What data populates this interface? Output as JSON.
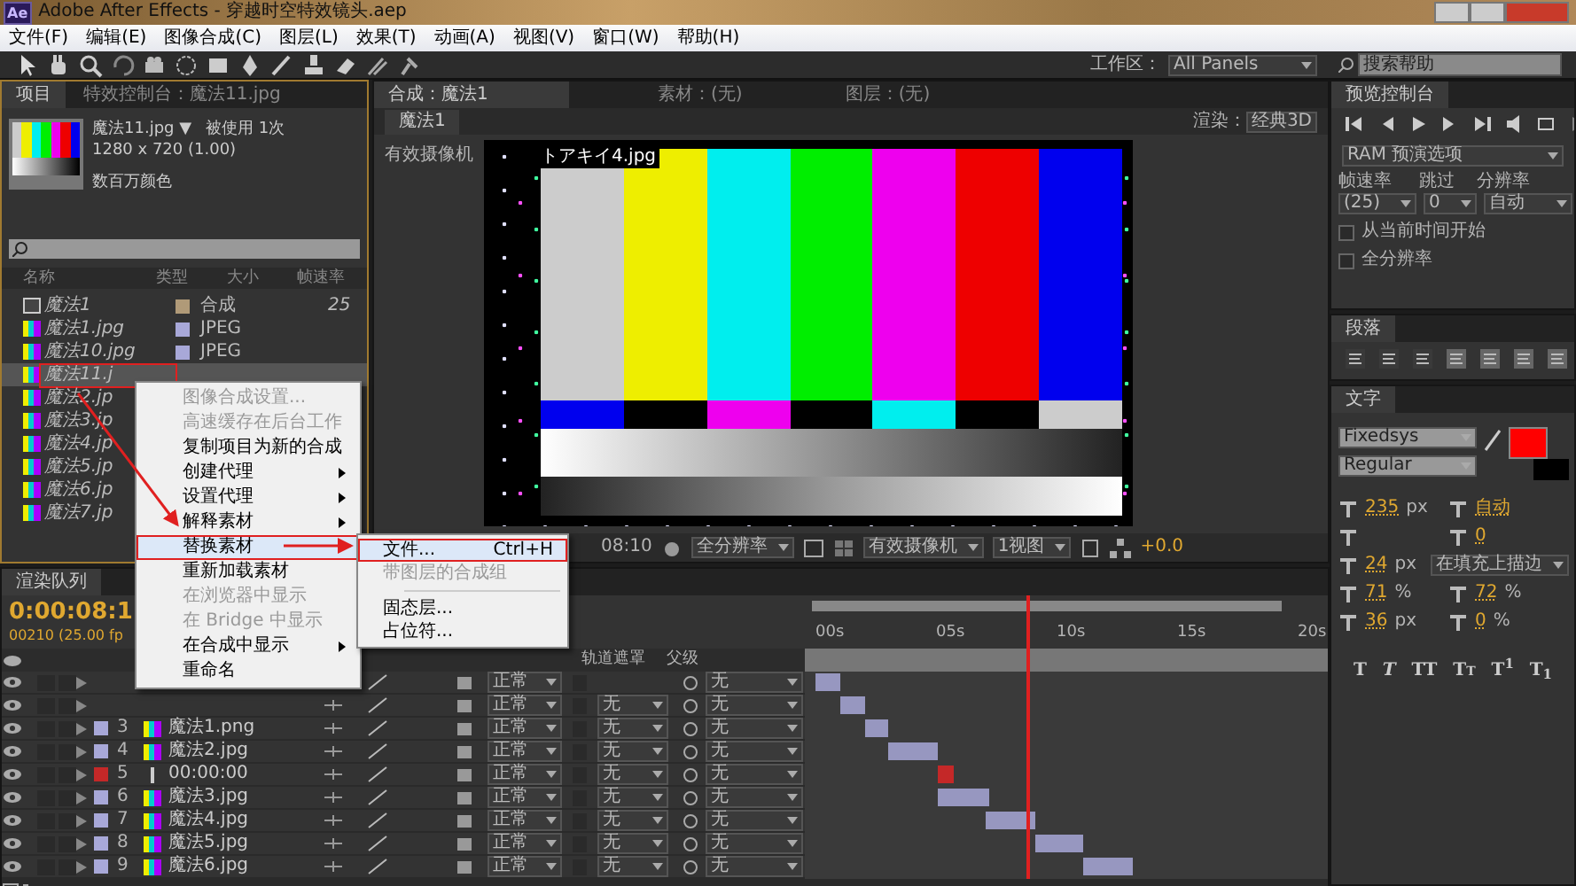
{
  "window": {
    "app_icon": "Ae",
    "title": "Adobe After Effects - 穿越时空特效镜头.aep"
  },
  "menu_bar": [
    "文件(F)",
    "编辑(E)",
    "图像合成(C)",
    "图层(L)",
    "效果(T)",
    "动画(A)",
    "视图(V)",
    "窗口(W)",
    "帮助(H)"
  ],
  "toolbar": {
    "workspace_label": "工作区：",
    "workspace": "All Panels",
    "search": {
      "placeholder": "搜索帮助"
    }
  },
  "project_panel": {
    "tabs": [
      {
        "label": "项目",
        "selected": true
      },
      {
        "label": "特效控制台：魔法11.jpg",
        "selected": false
      }
    ],
    "info": {
      "name": "魔法11.jpg ▼",
      "usage": "被使用 1次",
      "size": "1280 x 720 (1.00)",
      "color_depth": "数百万颜色"
    },
    "columns": [
      "名称",
      "类型",
      "大小",
      "帧速率"
    ],
    "items": [
      {
        "name": "魔法1",
        "kind": "comp",
        "color": "#b09a78",
        "type": "合成",
        "fps": "25",
        "selected": false
      },
      {
        "name": "魔法1.jpg",
        "kind": "footage",
        "color": "#a8a8d8",
        "type": "JPEG",
        "selected": false
      },
      {
        "name": "魔法10.jpg",
        "kind": "footage",
        "color": "#a8a8d8",
        "type": "JPEG",
        "selected": false
      },
      {
        "name": "魔法11.j",
        "kind": "footage",
        "selected": true
      },
      {
        "name": "魔法2.jp",
        "kind": "footage",
        "selected": false
      },
      {
        "name": "魔法3.jp",
        "kind": "footage",
        "selected": false
      },
      {
        "name": "魔法4.jp",
        "kind": "footage",
        "selected": false
      },
      {
        "name": "魔法5.jp",
        "kind": "footage",
        "selected": false
      },
      {
        "name": "魔法6.jp",
        "kind": "footage",
        "selected": false
      },
      {
        "name": "魔法7.jp",
        "kind": "footage",
        "selected": false
      }
    ]
  },
  "context_menu": {
    "items": [
      {
        "label": "图像合成设置...",
        "disabled": true,
        "submenu": false,
        "selected": false
      },
      {
        "label": "高速缓存在后台工作",
        "disabled": true,
        "submenu": false,
        "selected": false
      },
      {
        "label": "复制项目为新的合成",
        "disabled": false,
        "submenu": false,
        "selected": false
      },
      {
        "label": "创建代理",
        "disabled": false,
        "submenu": true,
        "selected": false
      },
      {
        "label": "设置代理",
        "disabled": false,
        "submenu": true,
        "selected": false
      },
      {
        "label": "解释素材",
        "disabled": false,
        "submenu": true,
        "selected": false
      },
      {
        "label": "替换素材",
        "disabled": false,
        "submenu": true,
        "selected": true
      },
      {
        "label": "重新加载素材",
        "disabled": false,
        "submenu": false,
        "selected": false
      },
      {
        "label": "在浏览器中显示",
        "disabled": true,
        "submenu": false,
        "selected": false
      },
      {
        "label": "在 Bridge 中显示",
        "disabled": true,
        "submenu": false,
        "selected": false
      },
      {
        "label": "在合成中显示",
        "disabled": false,
        "submenu": true,
        "selected": false
      },
      {
        "label": "重命名",
        "disabled": false,
        "submenu": false,
        "selected": false
      }
    ],
    "submenu": [
      {
        "label": "文件...",
        "shortcut": "Ctrl+H",
        "disabled": false,
        "selected": true
      },
      {
        "label": "带图层的合成组",
        "disabled": true,
        "selected": false
      },
      {
        "kind": "separator"
      },
      {
        "label": "固态层...",
        "disabled": false,
        "selected": false
      },
      {
        "label": "占位符...",
        "disabled": false,
        "selected": false
      }
    ]
  },
  "composition_panel": {
    "tabs": [
      {
        "label": "合成：魔法1",
        "selected": true
      },
      {
        "label": "素材：(无)",
        "selected": false
      },
      {
        "label": "图层：(无)",
        "selected": false
      }
    ],
    "comp_tab": "魔法1",
    "renderer_label": "渲染：",
    "renderer": "经典3D",
    "camera_label": "有效摄像机",
    "frame_label": "トアキイ4.jpg",
    "footer": {
      "timecode": "08:10",
      "resolution": "全分辨率",
      "camera": "有效摄像机",
      "views": "1视图",
      "exposure": "+0.0"
    }
  },
  "preview_panel": {
    "tab": "预览控制台",
    "ram_options": "RAM 预演选项",
    "labels": [
      "帧速率",
      "跳过",
      "分辨率"
    ],
    "values": [
      "(25)",
      "0",
      "自动"
    ],
    "checkboxes": [
      {
        "label": "从当前时间开始",
        "checked": false
      },
      {
        "label": "全分辨率",
        "checked": false
      }
    ]
  },
  "paragraph_panel": {
    "tab": "段落"
  },
  "character_panel": {
    "tab": "文字",
    "font": "Fixedsys",
    "style": "Regular",
    "swatches": [
      {
        "kind": "fill",
        "color": "#ff0000"
      },
      {
        "kind": "stroke",
        "color": "#000000"
      }
    ],
    "metric_rows": [
      {
        "left": {
          "value": "235",
          "unit": "px"
        },
        "right": {
          "value": "自动"
        }
      },
      {
        "right": {
          "value": "0"
        }
      },
      {
        "left": {
          "value": "24",
          "unit": "px"
        },
        "right": {
          "value": "在填充上描边",
          "kind": "dropdown"
        }
      },
      {
        "left": {
          "value": "71",
          "unit": "%"
        },
        "right": {
          "value": "72",
          "unit": "%"
        }
      },
      {
        "left": {
          "value": "36",
          "unit": "px"
        },
        "right": {
          "value": "0",
          "unit": "%"
        }
      }
    ],
    "style_buttons": [
      {
        "label": "T",
        "kind": "bold"
      },
      {
        "label": "T",
        "kind": "italic"
      },
      {
        "label": "TT",
        "kind": "caps"
      },
      {
        "label": "Tт",
        "kind": "smallcaps"
      },
      {
        "label": "T$^{1}$",
        "kind": "super"
      },
      {
        "label": "T$_{1}$",
        "kind": "sub"
      }
    ]
  },
  "timeline": {
    "tab": "渲染队列",
    "timecode": "0:00:08:1",
    "frames": "00210 (25.00 fp",
    "columns": [
      "轨道遮罩",
      "父级"
    ],
    "ruler": [
      "00s",
      "05s",
      "10s",
      "15s",
      "20s"
    ],
    "layers": [
      {
        "mode": "正常",
        "parent": "无"
      },
      {
        "mode": "正常",
        "trkmat": "无",
        "parent": "无"
      },
      {
        "number": "3",
        "name": "魔法1.png",
        "kind": "footage",
        "color": "#a8a8d8",
        "mode": "正常",
        "trkmat": "无",
        "parent": "无"
      },
      {
        "number": "4",
        "name": "魔法2.jpg",
        "kind": "footage",
        "color": "#a8a8d8",
        "mode": "正常",
        "trkmat": "无",
        "parent": "无"
      },
      {
        "number": "5",
        "name": "00:00:00",
        "kind": "text",
        "color": "#c42828",
        "mode": "正常",
        "trkmat": "无",
        "parent": "无"
      },
      {
        "number": "6",
        "name": "魔法3.jpg",
        "kind": "footage",
        "color": "#a8a8d8",
        "mode": "正常",
        "trkmat": "无",
        "parent": "无"
      },
      {
        "number": "7",
        "name": "魔法4.jpg",
        "kind": "footage",
        "color": "#a8a8d8",
        "mode": "正常",
        "trkmat": "无",
        "parent": "无"
      },
      {
        "number": "8",
        "name": "魔法5.jpg",
        "kind": "footage",
        "color": "#a8a8d8",
        "mode": "正常",
        "trkmat": "无",
        "parent": "无"
      },
      {
        "number": "9",
        "name": "魔法6.jpg",
        "kind": "footage",
        "color": "#a8a8d8",
        "mode": "正常",
        "trkmat": "无",
        "parent": "无"
      }
    ]
  }
}
